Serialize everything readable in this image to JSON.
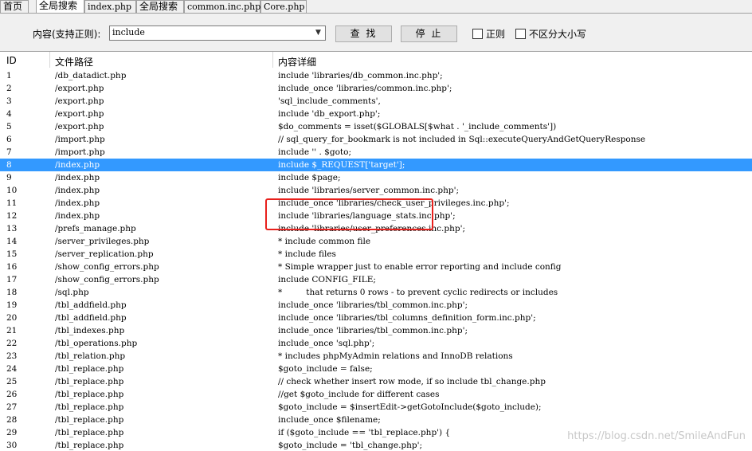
{
  "tabs": [
    {
      "label": "首页",
      "active": false
    },
    {
      "label": "全局搜索",
      "active": true
    },
    {
      "label": "index.php",
      "active": false
    },
    {
      "label": "全局搜索",
      "active": false
    },
    {
      "label": "common.inc.php",
      "active": false
    },
    {
      "label": "Core.php",
      "active": false
    }
  ],
  "search": {
    "label": "内容(支持正则):",
    "value": "include",
    "find_label": "查 找",
    "stop_label": "停 止",
    "regex_label": "正则",
    "ignore_case_label": "不区分大小写"
  },
  "table": {
    "headers": {
      "id": "ID",
      "path": "文件路径",
      "detail": "内容详细"
    },
    "selected_index": 7,
    "rows": [
      {
        "id": "1",
        "path": "/db_datadict.php",
        "detail": "include 'libraries/db_common.inc.php';"
      },
      {
        "id": "2",
        "path": "/export.php",
        "detail": "include_once 'libraries/common.inc.php';"
      },
      {
        "id": "3",
        "path": "/export.php",
        "detail": "'sql_include_comments',"
      },
      {
        "id": "4",
        "path": "/export.php",
        "detail": "include 'db_export.php';"
      },
      {
        "id": "5",
        "path": "/export.php",
        "detail": "$do_comments = isset($GLOBALS[$what . '_include_comments'])"
      },
      {
        "id": "6",
        "path": "/import.php",
        "detail": "// sql_query_for_bookmark is not included in Sql::executeQueryAndGetQueryResponse"
      },
      {
        "id": "7",
        "path": "/import.php",
        "detail": "include '' . $goto;"
      },
      {
        "id": "8",
        "path": "/index.php",
        "detail": "include $_REQUEST['target'];"
      },
      {
        "id": "9",
        "path": "/index.php",
        "detail": "include $page;"
      },
      {
        "id": "10",
        "path": "/index.php",
        "detail": "include 'libraries/server_common.inc.php';"
      },
      {
        "id": "11",
        "path": "/index.php",
        "detail": "include_once 'libraries/check_user_privileges.inc.php';"
      },
      {
        "id": "12",
        "path": "/index.php",
        "detail": "include 'libraries/language_stats.inc.php';"
      },
      {
        "id": "13",
        "path": "/prefs_manage.php",
        "detail": "include 'libraries/user_preferences.inc.php';"
      },
      {
        "id": "14",
        "path": "/server_privileges.php",
        "detail": "* include common file"
      },
      {
        "id": "15",
        "path": "/server_replication.php",
        "detail": "* include files"
      },
      {
        "id": "16",
        "path": "/show_config_errors.php",
        "detail": "* Simple wrapper just to enable error reporting and include config"
      },
      {
        "id": "17",
        "path": "/show_config_errors.php",
        "detail": "include CONFIG_FILE;"
      },
      {
        "id": "18",
        "path": "/sql.php",
        "detail": "*         that returns 0 rows - to prevent cyclic redirects or includes"
      },
      {
        "id": "19",
        "path": "/tbl_addfield.php",
        "detail": "include_once 'libraries/tbl_common.inc.php';"
      },
      {
        "id": "20",
        "path": "/tbl_addfield.php",
        "detail": "include_once 'libraries/tbl_columns_definition_form.inc.php';"
      },
      {
        "id": "21",
        "path": "/tbl_indexes.php",
        "detail": "include_once 'libraries/tbl_common.inc.php';"
      },
      {
        "id": "22",
        "path": "/tbl_operations.php",
        "detail": "include_once 'sql.php';"
      },
      {
        "id": "23",
        "path": "/tbl_relation.php",
        "detail": "* includes phpMyAdmin relations and InnoDB relations"
      },
      {
        "id": "24",
        "path": "/tbl_replace.php",
        "detail": "$goto_include = false;"
      },
      {
        "id": "25",
        "path": "/tbl_replace.php",
        "detail": "// check whether insert row mode, if so include tbl_change.php"
      },
      {
        "id": "26",
        "path": "/tbl_replace.php",
        "detail": "//get $goto_include for different cases"
      },
      {
        "id": "27",
        "path": "/tbl_replace.php",
        "detail": "$goto_include = $insertEdit->getGotoInclude($goto_include);"
      },
      {
        "id": "28",
        "path": "/tbl_replace.php",
        "detail": "include_once $filename;"
      },
      {
        "id": "29",
        "path": "/tbl_replace.php",
        "detail": "if ($goto_include == 'tbl_replace.php') {"
      },
      {
        "id": "30",
        "path": "/tbl_replace.php",
        "detail": "$goto_include = 'tbl_change.php';"
      }
    ]
  },
  "watermark": "https://blog.csdn.net/SmileAndFun",
  "colors": {
    "selection": "#3399ff",
    "annotation": "#e8201c"
  }
}
